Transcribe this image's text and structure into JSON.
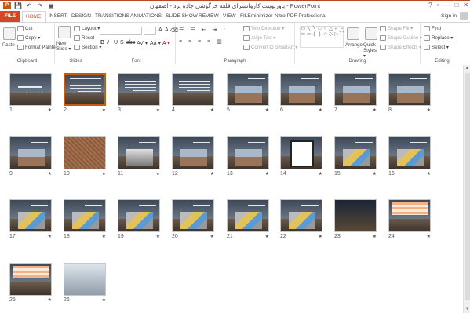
{
  "window": {
    "title": "پاورپوینت کاروانسرای قلعه خرگوشی جاده یزد - اصفهان - PowerPoint",
    "controls": [
      "?",
      "▫",
      "—",
      "□",
      "✕"
    ]
  },
  "qat": {
    "app_badge": "P",
    "save": "💾",
    "undo": "↶",
    "redo": "↷",
    "start": "▣"
  },
  "tabs": [
    {
      "label": "FILE"
    },
    {
      "label": "HOME"
    },
    {
      "label": "INSERT"
    },
    {
      "label": "DESIGN"
    },
    {
      "label": "TRANSITIONS"
    },
    {
      "label": "ANIMATIONS"
    },
    {
      "label": "SLIDE SHOW"
    },
    {
      "label": "REVIEW"
    },
    {
      "label": "VIEW"
    },
    {
      "label": "FILEminimizer"
    },
    {
      "label": "Nitro PDF Professional"
    }
  ],
  "signin": "Sign in",
  "ribbon": {
    "clipboard": {
      "label": "Clipboard",
      "paste": "Paste",
      "cut": "Cut",
      "copy": "Copy ▾",
      "format_painter": "Format Painter"
    },
    "slides": {
      "label": "Slides",
      "new_slide": "New Slide ▾",
      "layout": "Layout ▾",
      "reset": "Reset",
      "section": "Section ▾"
    },
    "font": {
      "label": "Font",
      "formats": [
        "B",
        "I",
        "U",
        "S",
        "abc",
        "AV ▾",
        "Aa ▾",
        "A ▾"
      ]
    },
    "paragraph": {
      "label": "Paragraph",
      "text_direction": "Text Direction ▾",
      "align_text": "Align Text ▾",
      "convert_smartart": "Convert to SmartArt ▾"
    },
    "drawing": {
      "label": "Drawing",
      "arrange": "Arrange",
      "quick_styles": "Quick Styles ▾",
      "shape_fill": "Shape Fill ▾",
      "shape_outline": "Shape Outline ▾",
      "shape_effects": "Shape Effects ▾",
      "shapes": [
        "▭",
        "╲",
        "╲",
        "□",
        "○",
        "△",
        "⌐",
        "⌐",
        "⇨",
        "⇦",
        "{",
        "}",
        "☆",
        "◇",
        "▷",
        "⌒"
      ]
    },
    "editing": {
      "label": "Editing",
      "find": "Find",
      "replace": "Replace ▾",
      "select": "Select ▾"
    }
  },
  "slides": [
    {
      "number": "1",
      "style": "title",
      "star": "★"
    },
    {
      "number": "2",
      "style": "text",
      "selected": true,
      "star": "★"
    },
    {
      "number": "3",
      "style": "text",
      "star": "★"
    },
    {
      "number": "4",
      "style": "text",
      "star": "★"
    },
    {
      "number": "5",
      "style": "photo",
      "star": "★"
    },
    {
      "number": "6",
      "style": "photo",
      "star": "★"
    },
    {
      "number": "7",
      "style": "photo",
      "star": "★"
    },
    {
      "number": "8",
      "style": "photo",
      "star": "★"
    },
    {
      "number": "9",
      "style": "photo",
      "star": "★"
    },
    {
      "number": "10",
      "style": "texture",
      "star": "★"
    },
    {
      "number": "11",
      "style": "bw",
      "star": "★"
    },
    {
      "number": "12",
      "style": "photo",
      "star": "★"
    },
    {
      "number": "13",
      "style": "photo",
      "star": "★"
    },
    {
      "number": "14",
      "style": "plan",
      "star": "★"
    },
    {
      "number": "15",
      "style": "plan3d",
      "star": "★"
    },
    {
      "number": "16",
      "style": "plan3d",
      "star": "★"
    },
    {
      "number": "17",
      "style": "plan3d",
      "star": "★"
    },
    {
      "number": "18",
      "style": "plan3d",
      "star": "★"
    },
    {
      "number": "19",
      "style": "plan3d",
      "star": "★"
    },
    {
      "number": "20",
      "style": "plan3d",
      "star": "★"
    },
    {
      "number": "21",
      "style": "plan3d",
      "star": "★"
    },
    {
      "number": "22",
      "style": "plan3d",
      "star": "★"
    },
    {
      "number": "23",
      "style": "night",
      "star": "★"
    },
    {
      "number": "24",
      "style": "table",
      "star": "★"
    },
    {
      "number": "25",
      "style": "table",
      "star": "★"
    },
    {
      "number": "26",
      "style": "laptop",
      "star": "★"
    }
  ],
  "colors": {
    "accent": "#b7472a",
    "file_tab": "#d24726",
    "selection": "#c55a11"
  }
}
